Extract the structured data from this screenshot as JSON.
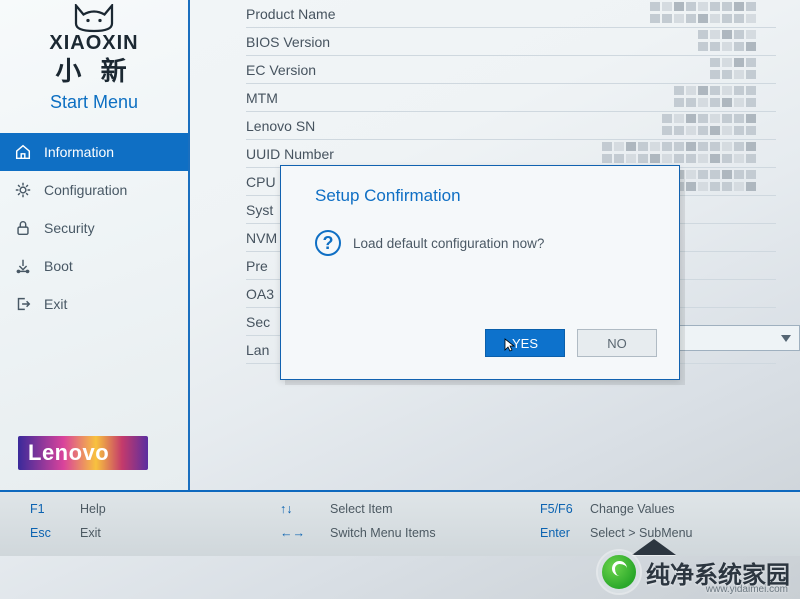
{
  "brand": {
    "wordmark": "XIAOXIN",
    "cn": "小 新",
    "start_menu": "Start Menu",
    "lenovo": "Lenovo"
  },
  "sidebar": {
    "items": [
      {
        "name": "information",
        "label": "Information",
        "icon": "home-icon",
        "selected": true
      },
      {
        "name": "configuration",
        "label": "Configuration",
        "icon": "gear-icon",
        "selected": false
      },
      {
        "name": "security",
        "label": "Security",
        "icon": "lock-icon",
        "selected": false
      },
      {
        "name": "boot",
        "label": "Boot",
        "icon": "boot-icon",
        "selected": false
      },
      {
        "name": "exit",
        "label": "Exit",
        "icon": "exit-icon",
        "selected": false
      }
    ]
  },
  "fields": [
    {
      "label": "Product Name"
    },
    {
      "label": "BIOS Version"
    },
    {
      "label": "EC Version"
    },
    {
      "label": "MTM"
    },
    {
      "label": "Lenovo SN"
    },
    {
      "label": "UUID Number"
    },
    {
      "label": "CPU"
    },
    {
      "label": "Syst"
    },
    {
      "label": "NVM"
    },
    {
      "label": "Pre"
    },
    {
      "label": "OA3"
    },
    {
      "label": "Sec"
    },
    {
      "label": "Lan"
    }
  ],
  "modal": {
    "title": "Setup Confirmation",
    "message": "Load default configuration now?",
    "yes": "YES",
    "no": "NO"
  },
  "footer": {
    "hints": [
      {
        "key": "F1",
        "text": "Help"
      },
      {
        "key": "↑↓",
        "text": "Select Item"
      },
      {
        "key": "F5/F6",
        "text": "Change Values"
      },
      {
        "key": "Esc",
        "text": "Exit"
      },
      {
        "key": "←→",
        "text": "Switch Menu Items"
      },
      {
        "key": "Enter",
        "text": "Select > SubMenu"
      }
    ]
  },
  "watermark": {
    "text": "纯净系统家园",
    "url": "www.yidaimei.com"
  }
}
